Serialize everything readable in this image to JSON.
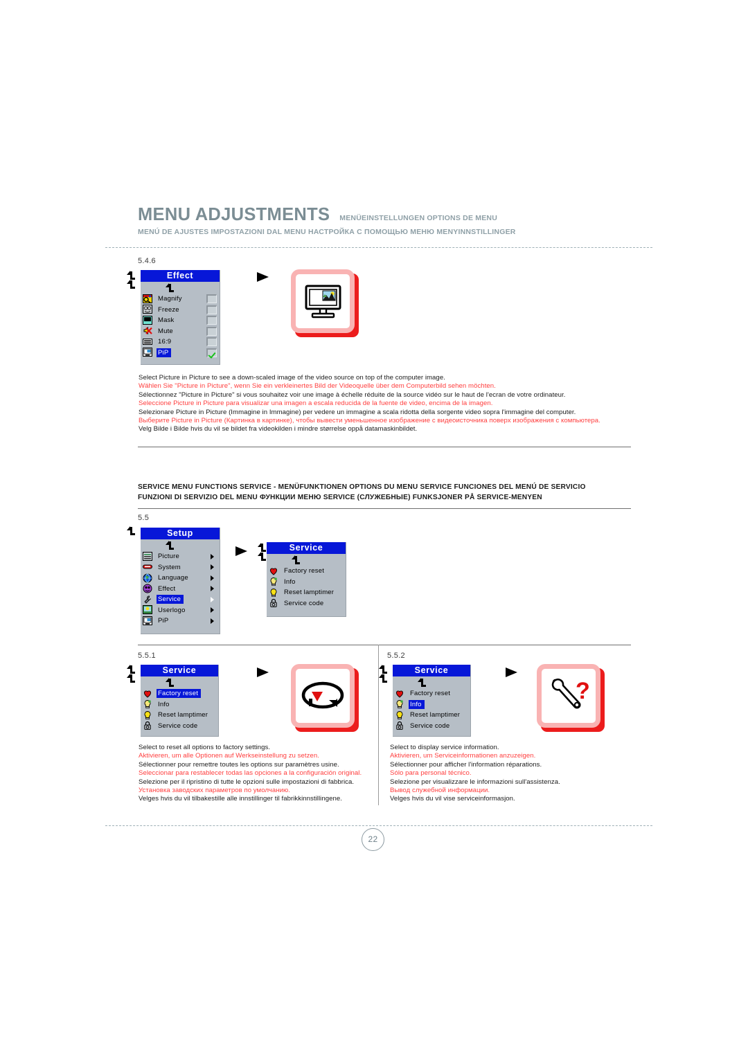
{
  "header": {
    "title": "MENU ADJUSTMENTS",
    "subtitle_line1": "MENÜEINSTELLUNGEN  OPTIONS DE MENU",
    "subtitle_line2": "MENÚ DE AJUSTES  IMPOSTAZIONI DAL MENU  НАСТРОЙКА С ПОМОЩЬЮ МЕНЮ  MENYINNSTILLINGER"
  },
  "colors": {
    "osd_title_blue": "#0717d8",
    "osd_background": "#b6bec6",
    "red_text": "#ff3d3d",
    "tile_red": "#ec1c1c",
    "tile_pink": "#f9b3b3",
    "header_gray": "#7b8d94"
  },
  "section_546": {
    "number": "5.4.6",
    "menu": {
      "title": "Effect",
      "items": [
        {
          "label": "Magnify",
          "icon": "magnify-icon",
          "checked": false,
          "selected": false
        },
        {
          "label": "Freeze",
          "icon": "freeze-icon",
          "checked": false,
          "selected": false
        },
        {
          "label": "Mask",
          "icon": "mask-icon",
          "checked": false,
          "selected": false
        },
        {
          "label": "Mute",
          "icon": "mute-icon",
          "checked": false,
          "selected": false
        },
        {
          "label": "16:9",
          "icon": "widescreen-icon",
          "checked": false,
          "selected": false
        },
        {
          "label": "PiP",
          "icon": "pip-icon",
          "checked": true,
          "selected": true
        }
      ]
    },
    "illustration": "monitor-pip-icon",
    "text": [
      {
        "lang": "en",
        "red": false,
        "value": "Select Picture in Picture to see a down-scaled image of the video source on top of the computer image."
      },
      {
        "lang": "de",
        "red": true,
        "value": "Wählen Sie \"Picture in Picture\", wenn Sie ein verkleinertes Bild der Videoquelle über dem Computerbild sehen möchten."
      },
      {
        "lang": "fr",
        "red": false,
        "value": "Sélectionnez \"Picture in Picture\" si vous souhaitez voir une image à échelle réduite de la source vidéo sur le haut de l'ecran de votre ordinateur."
      },
      {
        "lang": "es",
        "red": true,
        "value": "Seleccione Picture in Picture para visualizar una imagen a escala reducida de la fuente de video, encima de la imagen."
      },
      {
        "lang": "it",
        "red": false,
        "value": "Selezionare Picture in Picture (Immagine in Immagine) per vedere un immagine a scala ridotta della sorgente video sopra l'immagine del computer."
      },
      {
        "lang": "ru",
        "red": true,
        "value": "Выберите Picture in Picture (Картинка в картинке), чтобы вывести уменьшенное изображение с видеоисточника поверх изображения с компьютера."
      },
      {
        "lang": "no",
        "red": false,
        "value": "Velg Bilde i Bilde hvis du vil se bildet fra videokilden i mindre størrelse oppå datamaskinbildet."
      }
    ]
  },
  "service_heading": {
    "line1": "SERVICE MENU FUNCTIONS   SERVICE - MENÜFUNKTIONEN   OPTIONS DU MENU SERVICE   FUNCIONES DEL MENÚ DE SERVICIO",
    "line2": "FUNZIONI DI SERVIZIO DEL MENU   ФУНКЦИИ МЕНЮ SERVICE (СЛУЖЕБНЫЕ)   FUNKSJONER PÅ SERVICE-MENYEN"
  },
  "section_55": {
    "number": "5.5",
    "setup_menu": {
      "title": "Setup",
      "items": [
        {
          "label": "Picture",
          "icon": "picture-icon",
          "selected": false,
          "arrow": true
        },
        {
          "label": "System",
          "icon": "system-icon",
          "selected": false,
          "arrow": true
        },
        {
          "label": "Language",
          "icon": "language-icon",
          "selected": false,
          "arrow": true
        },
        {
          "label": "Effect",
          "icon": "effect-icon",
          "selected": false,
          "arrow": true
        },
        {
          "label": "Service",
          "icon": "service-wrench-icon",
          "selected": true,
          "arrow": true
        },
        {
          "label": "Userlogo",
          "icon": "userlogo-icon",
          "selected": false,
          "arrow": true
        },
        {
          "label": "PiP",
          "icon": "pip-icon",
          "selected": false,
          "arrow": true
        }
      ]
    },
    "service_menu": {
      "title": "Service",
      "items": [
        {
          "label": "Factory reset",
          "icon": "factory-reset-icon",
          "selected": false
        },
        {
          "label": "Info",
          "icon": "info-bulb-icon",
          "selected": false
        },
        {
          "label": "Reset lamptimer",
          "icon": "lamptimer-icon",
          "selected": false
        },
        {
          "label": "Service code",
          "icon": "service-code-lock-icon",
          "selected": false
        }
      ]
    }
  },
  "section_551": {
    "number": "5.5.1",
    "menu": {
      "title": "Service",
      "items": [
        {
          "label": "Factory reset",
          "icon": "factory-reset-icon",
          "selected": true
        },
        {
          "label": "Info",
          "icon": "info-bulb-icon",
          "selected": false
        },
        {
          "label": "Reset lamptimer",
          "icon": "lamptimer-icon",
          "selected": false
        },
        {
          "label": "Service code",
          "icon": "service-code-lock-icon",
          "selected": false
        }
      ]
    },
    "illustration": "reset-loop-icon",
    "text": [
      {
        "lang": "en",
        "red": false,
        "value": "Select to reset all options to factory settings."
      },
      {
        "lang": "de",
        "red": true,
        "value": "Aktivieren, um alle Optionen auf Werkseinstellung zu setzen."
      },
      {
        "lang": "fr",
        "red": false,
        "value": "Sélectionner pour remettre toutes les options sur paramètres usine."
      },
      {
        "lang": "es",
        "red": true,
        "value": "Seleccionar para restablecer todas las opciones a la configuración original."
      },
      {
        "lang": "it",
        "red": false,
        "value": "Selezione per il ripristino di tutte le opzioni sulle impostazioni di fabbrica."
      },
      {
        "lang": "ru",
        "red": true,
        "value": "Установка заводских параметров по умолчанию."
      },
      {
        "lang": "no",
        "red": false,
        "value": "Velges hvis du vil tilbakestille alle innstillinger til fabrikkinnstillingene."
      }
    ]
  },
  "section_552": {
    "number": "5.5.2",
    "menu": {
      "title": "Service",
      "items": [
        {
          "label": "Factory reset",
          "icon": "factory-reset-icon",
          "selected": false
        },
        {
          "label": "Info",
          "icon": "info-bulb-icon",
          "selected": true
        },
        {
          "label": "Reset lamptimer",
          "icon": "lamptimer-icon",
          "selected": false
        },
        {
          "label": "Service code",
          "icon": "service-code-lock-icon",
          "selected": false
        }
      ]
    },
    "illustration": "wrench-question-icon",
    "text": [
      {
        "lang": "en",
        "red": false,
        "value": "Select to display service information."
      },
      {
        "lang": "de",
        "red": true,
        "value": "Aktivieren, um Serviceinformationen anzuzeigen."
      },
      {
        "lang": "fr",
        "red": false,
        "value": "Sélectionner pour afficher l'information réparations."
      },
      {
        "lang": "es",
        "red": true,
        "value": "Sólo para personal técnico."
      },
      {
        "lang": "it",
        "red": false,
        "value": "Selezione per visualizzare le informazioni sull'assistenza."
      },
      {
        "lang": "ru",
        "red": true,
        "value": "Вывод служебной информации."
      },
      {
        "lang": "no",
        "red": false,
        "value": "Velges hvis du vil vise serviceinformasjon."
      }
    ]
  },
  "page_number": "22"
}
